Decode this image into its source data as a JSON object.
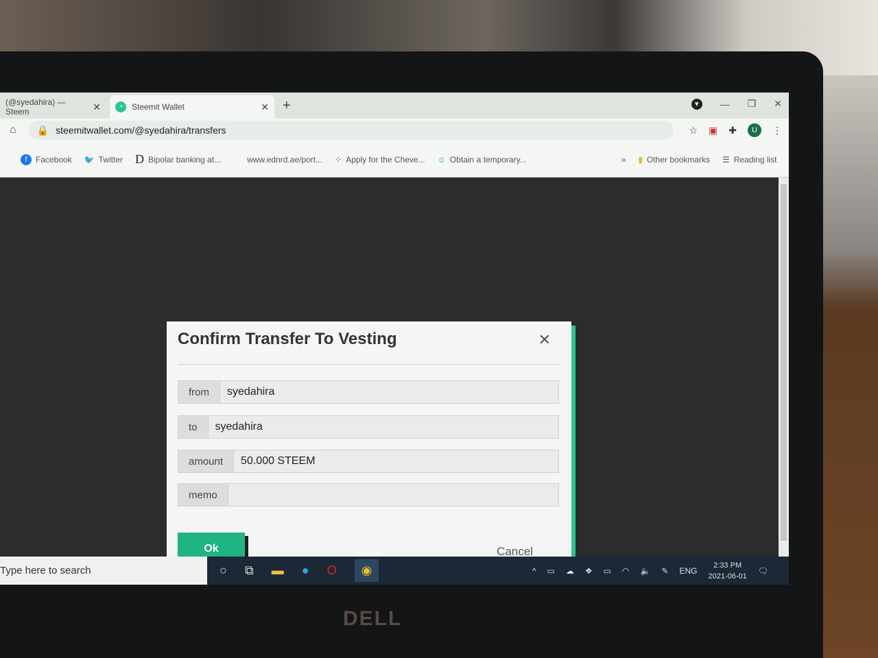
{
  "browser": {
    "tabs": [
      {
        "label": "(@syedahira) — Steem",
        "active": false
      },
      {
        "label": "Steemit Wallet",
        "active": true
      }
    ],
    "url": "steemitwallet.com/@syedahira/transfers",
    "profile_initial": "U",
    "bookmarks": [
      {
        "label": "Facebook",
        "icon": "facebook-icon"
      },
      {
        "label": "Twitter",
        "icon": "twitter-icon"
      },
      {
        "label": "Bipolar banking at...",
        "icon": "d-icon"
      },
      {
        "label": "www.ednrd.ae/port...",
        "icon": "none"
      },
      {
        "label": "Apply for the Cheve...",
        "icon": "dots-icon"
      },
      {
        "label": "Obtain a temporary...",
        "icon": "smile-icon"
      }
    ],
    "more_bookmarks": "»",
    "other_bookmarks": "Other bookmarks",
    "reading_list": "Reading list"
  },
  "modal": {
    "title": "Confirm Transfer To Vesting",
    "fields": [
      {
        "label": "from",
        "value": "syedahira"
      },
      {
        "label": "to",
        "value": "syedahira"
      },
      {
        "label": "amount",
        "value": "50.000 STEEM"
      },
      {
        "label": "memo",
        "value": ""
      }
    ],
    "ok_label": "Ok",
    "cancel_label": "Cancel",
    "accent_color": "#20b383"
  },
  "taskbar": {
    "search_placeholder": "Type here to search",
    "language": "ENG",
    "time": "2:33 PM",
    "date": "2021-06-01"
  },
  "brand": "DELL"
}
